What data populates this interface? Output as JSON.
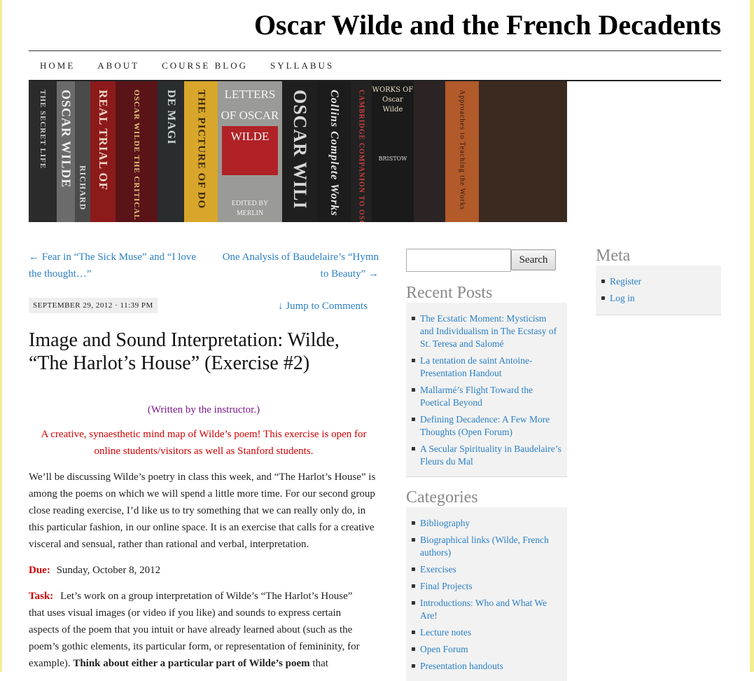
{
  "site": {
    "title": "Oscar Wilde and the French Decadents"
  },
  "nav": [
    "HOME",
    "ABOUT",
    "COURSE BLOG",
    "SYLLABUS"
  ],
  "banner_spines": [
    {
      "text": "THE SECRET LIFE",
      "color": "#2b2b2b"
    },
    {
      "text": "OSCAR WILDE",
      "color": "#6b6b6b"
    },
    {
      "text": "RICHARD",
      "color": "#4a4a4a"
    },
    {
      "text": "REAL TRIAL OF",
      "color": "#8c1a1a"
    },
    {
      "text": "OSCAR WILDE THE CRITICAL HERITAGE",
      "color": "#5a1418"
    },
    {
      "text": "DE MAGI",
      "color": "#2a2d2e"
    },
    {
      "text": "THE PICTURE OF DO",
      "color": "#d8a62a"
    },
    {
      "text": "LETTERS OF OSCAR WILDE",
      "color": "#9a9a96"
    },
    {
      "text": "EDITED BY MERLIN",
      "color": "#9a9a96"
    },
    {
      "text": "OSCAR WILI",
      "color": "#1f1f1f"
    },
    {
      "text": "Collins Complete Works",
      "color": "#1c1c1c"
    },
    {
      "text": "CAMBRIDGE COMPANION TO OSCAR WI",
      "color": "#222"
    },
    {
      "text": "WORKS OF Oscar Wilde",
      "color": "#1a1a1a"
    },
    {
      "text": "BRISTOW",
      "color": "#1a1a1a"
    },
    {
      "text": "Approaches to Teaching the Works",
      "color": "#b25a2a"
    }
  ],
  "post": {
    "prev_link": "← Fear in “The Sick Muse” and “I love the thought…”",
    "next_link": "One Analysis of Baudelaire’s “Hymn to Beauty” →",
    "date": "SEPTEMBER 29, 2012 · 11:39 PM",
    "jump": "↓ Jump to Comments",
    "title": "Image and Sound Interpretation: Wilde, “The Harlot’s House” (Exercise #2)",
    "written_by": "(Written by the instructor.)",
    "intro": "A creative, synaesthetic mind map of Wilde’s poem!  This exercise is open for online students/visitors as well as Stanford students.",
    "para1": "We’ll be discussing Wilde’s poetry in class this week, and “The Harlot’s House” is among the poems on which we will spend a little more time.  For our second group close reading exercise, I’d like us to try something that we can really only do, in this particular fashion, in our online space.  It is an exercise that calls for a creative visceral and sensual, rather than rational and verbal, interpretation.",
    "due_label": "Due:",
    "due_value": "Sunday, October 8, 2012",
    "task_label": "Task:",
    "task_text": "Let’s work on a group interpretation of Wilde’s “The Harlot’s House” that uses visual images (or video if you like) and sounds to express certain aspects of the poem that you intuit or have already learned about (such as the poem’s gothic elements, its particular form, or representation of femininity, for example).",
    "task_bold": "Think about either a particular part of Wilde’s poem",
    "task_tail": "that"
  },
  "sidebar": {
    "search_button": "Search",
    "recent_title": "Recent Posts",
    "recent": [
      "The Ecstatic Moment: Mysticism and Individualism in The Ecstasy of St. Teresa and Salomé",
      "La tentation de saint Antoine- Presentation Handout",
      "Mallarmé’s Flight Toward the Poetical Beyond",
      "Defining Decadence: A Few More Thoughts (Open Forum)",
      "A Secular Spirituality in Baudelaire’s Fleurs du Mal"
    ],
    "categories_title": "Categories",
    "categories": [
      "Bibliography",
      "Biographical links (Wilde, French authors)",
      "Exercises",
      "Final Projects",
      "Introductions: Who and What We Are!",
      "Lecture notes",
      "Open Forum",
      "Presentation handouts"
    ],
    "meta_title": "Meta",
    "meta": [
      "Register",
      "Log in"
    ]
  }
}
